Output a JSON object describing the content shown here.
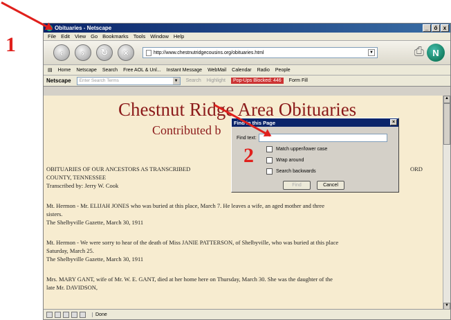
{
  "window": {
    "title": "Obituaries - Netscape",
    "buttons": [
      "_",
      "ő",
      "x"
    ]
  },
  "menu": [
    "File",
    "Edit",
    "View",
    "Go",
    "Bookmarks",
    "Tools",
    "Window",
    "Help"
  ],
  "nav": {
    "url": "http://www.chestnutridgecousins.org/obituaries.html"
  },
  "personal_toolbar": [
    "Home",
    "Netscape",
    "Search",
    "Free AOL & Unl...",
    "Instant Message",
    "WebMail",
    "Calendar",
    "Radio",
    "People"
  ],
  "search_toolbar": {
    "brand": "Netscape",
    "placeholder": "Enter Search Terms",
    "search": "Search",
    "highlight": "Highlight",
    "popups": "Pop-Ups Blocked: 446",
    "formfill": "Form Fill"
  },
  "page": {
    "title": "Chestnut Ridge Area Obituaries",
    "subtitle": "Contributed b",
    "paras": [
      {
        "text": "OBITUARIES OF OUR ANCESTORS AS TRANSCRIBED",
        "tail": "ORD"
      },
      {
        "text": "COUNTY, TENNESSEE"
      },
      {
        "text": "Transcribed by: Jerry W. Cook"
      },
      {
        "text": "Mt. Hermon - Mr. ELIJAH JONES who was buried at this place, March 7. He leaves a wife,  an aged mother and three"
      },
      {
        "text": "sisters."
      },
      {
        "text": "The Shelbyville Gazette, March 30, 1911"
      },
      {
        "text": "Mt. Hermon - We were sorry to hear of the death of Miss JANIE PATTERSON, of Shelbyville, who was buried at this place"
      },
      {
        "text": "Saturday, March 25."
      },
      {
        "text": "The Shelbyville Gazette, March 30, 1911"
      },
      {
        "text": "Mrs. MARY GANT, wife of  Mr. W. E. GANT, died at her home here on Thursday, March 30. She was the daughter of the"
      },
      {
        "text": "late Mr. DAVIDSON,"
      }
    ]
  },
  "status": {
    "text": "Done"
  },
  "dialog": {
    "title": "Find in this Page",
    "find_label": "Find text:",
    "options": [
      "Match upper/lower case",
      "Wrap around",
      "Search backwards"
    ],
    "find_button": "Find",
    "cancel_button": "Cancel"
  },
  "annotations": {
    "n1": "1",
    "n2": "2"
  }
}
